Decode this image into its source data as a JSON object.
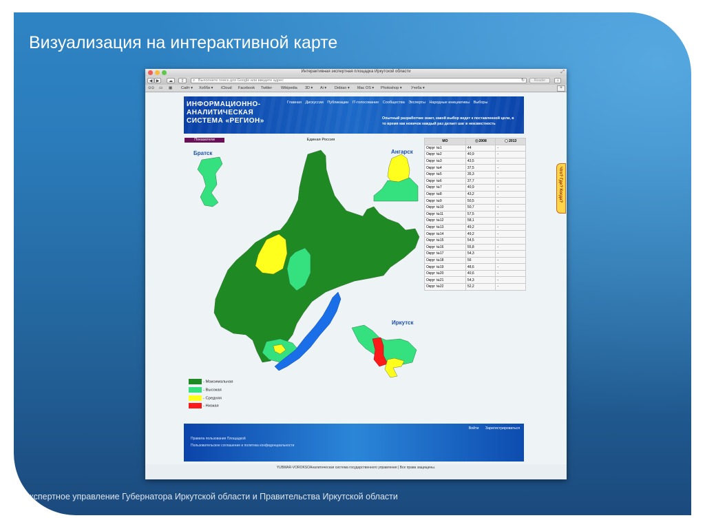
{
  "slide": {
    "title": "Визуализация на интерактивной карте",
    "footer": "Экспертное управление Губернатора Иркутской области и Правительства Иркутской области"
  },
  "browser": {
    "window_title": "Интерактивная экспертная площадка Иркутской области",
    "address_placeholder": "Выполните поиск для Google или введите адрес",
    "reader_label": "Reader",
    "bookmarks": [
      "Сайт ▾",
      "Хобби ▾",
      "iCloud",
      "Facebook",
      "Twitter",
      "Wikipedia",
      "3D ▾",
      "Ai ▾",
      "Debian ▾",
      "Mac OS ▾",
      "Photoshop ▾",
      "Учеба ▾"
    ]
  },
  "site": {
    "logo_lines": [
      "ИНФОРМАЦИОННО-",
      "АНАЛИТИЧЕСКАЯ",
      "СИСТЕМА «РЕГИОН»"
    ],
    "nav": [
      "Главная",
      "Дискуссии",
      "Публикации",
      "IT-голосование",
      "Сообщества",
      "Эксперты",
      "Народные инициативы",
      "Выборы"
    ],
    "tagline": "Опытный разработчик знает, какой выбор ведет к поставленной цели, в то время как новичок каждый раз делает шаг в неизвестность",
    "indicators_button": "Показатели",
    "party": "Единая Россия",
    "side_tab": "Что? Где? Когда?",
    "footer_links": [
      "Войти",
      "Зарегистрироваться"
    ],
    "footer_line1": "Правила пользования Площадкой",
    "footer_line2": "Пользовательское соглашение и политика конфиденциальности",
    "copyright": "YUBMAR-VOROKSOАналитическая система государственного управления | Все права защищены."
  },
  "map_labels": {
    "bratsk": "Братск",
    "angarsk": "Ангарск",
    "irkutsk": "Иркутск"
  },
  "legend": [
    {
      "label": "- Максимальная",
      "color": "#1f8a24"
    },
    {
      "label": "- Высокая",
      "color": "#35e07f"
    },
    {
      "label": "- Средняя",
      "color": "#ffff1e"
    },
    {
      "label": "- Низкая",
      "color": "#ff1a1a"
    }
  ],
  "colors": {
    "max": "#1f8a24",
    "high": "#35e07f",
    "mid": "#ffff1e",
    "low": "#ff1a1a",
    "water": "#1a6fe8"
  },
  "table": {
    "headers": [
      "МО",
      "2008",
      "2013"
    ],
    "selected_year": "2008",
    "rows": [
      [
        "Округ №1",
        "44",
        "-"
      ],
      [
        "Округ №2",
        "40,9",
        "-"
      ],
      [
        "Округ №3",
        "43,5",
        "-"
      ],
      [
        "Округ №4",
        "37,5",
        "-"
      ],
      [
        "Округ №5",
        "35,3",
        "-"
      ],
      [
        "Округ №6",
        "37,7",
        "-"
      ],
      [
        "Округ №7",
        "40,9",
        "-"
      ],
      [
        "Округ №8",
        "43,2",
        "-"
      ],
      [
        "Округ №9",
        "50,5",
        "-"
      ],
      [
        "Округ №10",
        "50,7",
        "-"
      ],
      [
        "Округ №11",
        "57,5",
        "-"
      ],
      [
        "Округ №12",
        "58,1",
        "-"
      ],
      [
        "Округ №13",
        "49,2",
        "-"
      ],
      [
        "Округ №14",
        "49,2",
        "-"
      ],
      [
        "Округ №15",
        "54,5",
        "-"
      ],
      [
        "Округ №16",
        "55,8",
        "-"
      ],
      [
        "Округ №17",
        "54,3",
        "-"
      ],
      [
        "Округ №18",
        "56",
        "-"
      ],
      [
        "Округ №19",
        "48,6",
        "-"
      ],
      [
        "Округ №20",
        "40,6",
        "-"
      ],
      [
        "Округ №21",
        "54,3",
        "-"
      ],
      [
        "Округ №22",
        "52,2",
        "-"
      ]
    ]
  }
}
